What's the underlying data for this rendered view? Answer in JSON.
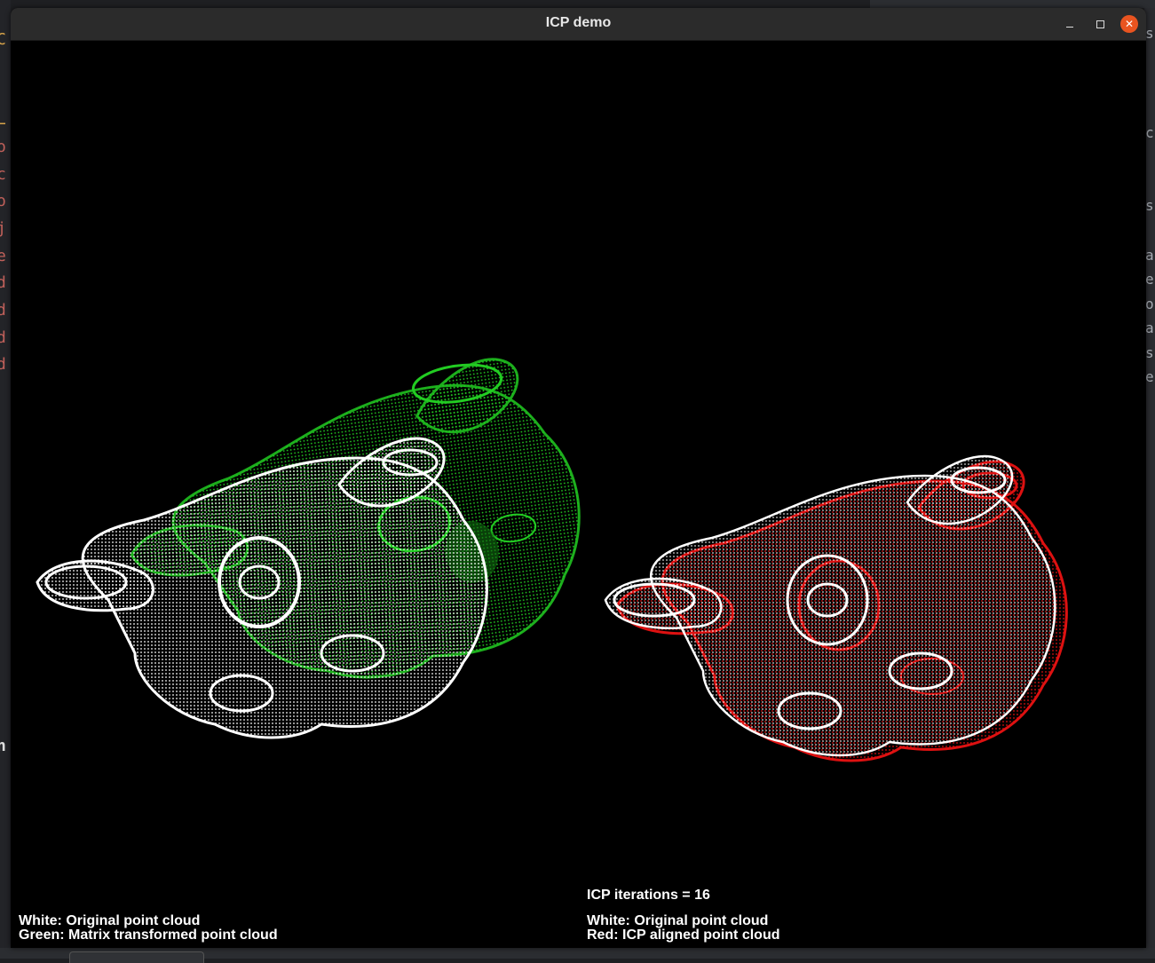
{
  "window": {
    "title": "ICP demo",
    "buttons": {
      "minimize": "minimize-icon",
      "maximize": "maximize-icon",
      "close": "close-icon"
    }
  },
  "left_view": {
    "legend_line1": "White: Original point cloud",
    "legend_line2": "Green: Matrix transformed point cloud",
    "colors": {
      "original": "#ffffff",
      "transformed": "#22cc22"
    }
  },
  "right_view": {
    "iterations": "ICP iterations = 16",
    "legend_line1": "White: Original point cloud",
    "legend_line2": "Red: ICP aligned point cloud",
    "colors": {
      "original": "#ffffff",
      "aligned": "#dd1111"
    }
  }
}
